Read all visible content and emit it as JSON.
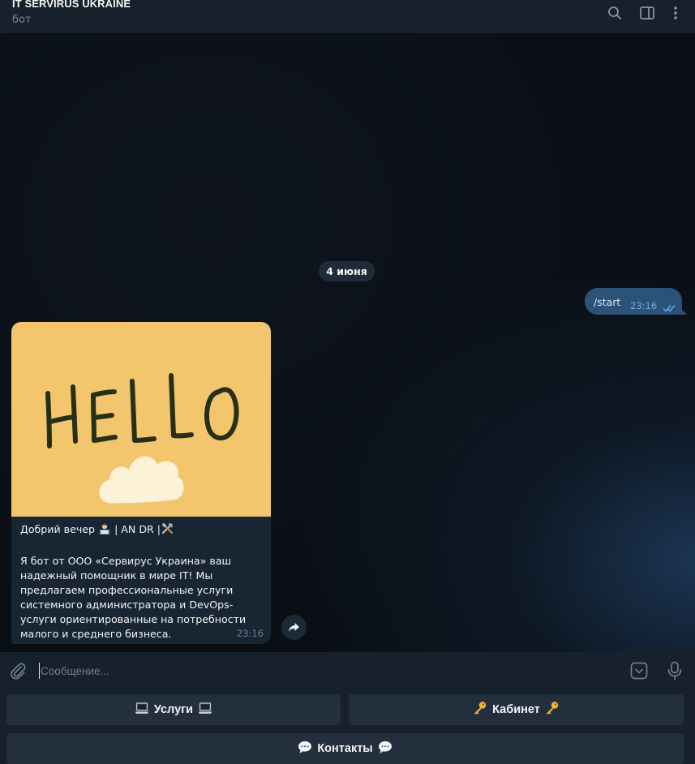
{
  "header": {
    "title": "IT SERVIRUS UKRAINE",
    "subtitle": "бот",
    "icons": [
      "search-icon",
      "sidebar-toggle-icon",
      "more-vertical-icon"
    ]
  },
  "chat": {
    "date_separator": "4 июня",
    "outgoing": {
      "text": "/start",
      "time": "23:16",
      "status": "read"
    },
    "incoming": {
      "image_text": "HELLO",
      "greeting": "Добрий вечер",
      "greeting_tail": "| AN DR |",
      "body": "Я бот от ООО «Сервирус Украина» ваш надежный помощник в мире IT! Мы предлагаем профессиональные услуги системного администратора и DevOps-услуги ориентированные на потребности малого и среднего бизнеса.",
      "time": "23:16"
    }
  },
  "composer": {
    "placeholder": "Сообщение..."
  },
  "bot_keyboard": {
    "services": "Услуги",
    "cabinet": "Кабинет",
    "contacts": "Контакты"
  },
  "colors": {
    "header_bg": "#17212b",
    "outgoing_bubble": "#2b5278",
    "incoming_bubble": "#182533",
    "image_bg": "#f3c56c",
    "key_bg": "#232f3d"
  }
}
